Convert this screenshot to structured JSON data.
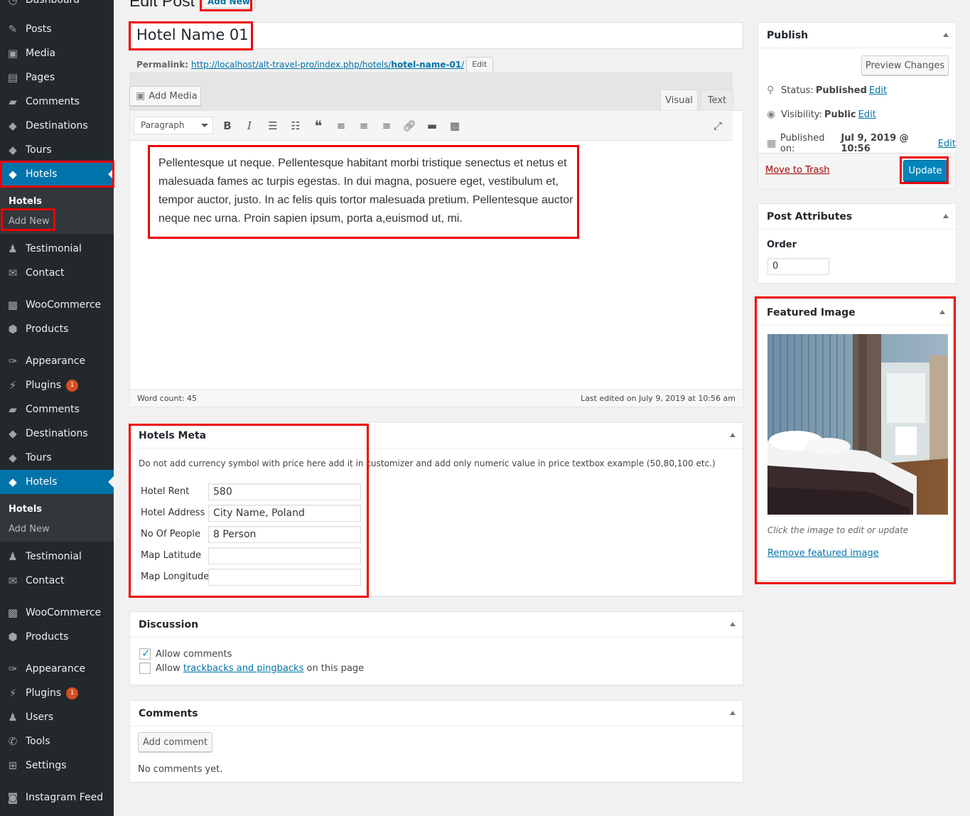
{
  "sidebar": {
    "items": [
      {
        "label": "Dashboard",
        "icon": "dashboard-icon"
      },
      {
        "label": "Posts",
        "icon": "pin-icon"
      },
      {
        "label": "Media",
        "icon": "media-icon"
      },
      {
        "label": "Pages",
        "icon": "pages-icon"
      },
      {
        "label": "Comments",
        "icon": "comment-icon"
      },
      {
        "label": "Destinations",
        "icon": "graduation-cap-icon"
      },
      {
        "label": "Tours",
        "icon": "graduation-cap-icon"
      },
      {
        "label": "Hotels",
        "icon": "graduation-cap-icon"
      },
      {
        "label": "Testimonial",
        "icon": "person-icon"
      },
      {
        "label": "Contact",
        "icon": "envelope-icon"
      },
      {
        "label": "WooCommerce",
        "icon": "woo-icon"
      },
      {
        "label": "Products",
        "icon": "box-icon"
      },
      {
        "label": "Appearance",
        "icon": "brush-icon"
      },
      {
        "label": "Plugins",
        "icon": "plug-icon",
        "badge": "1"
      },
      {
        "label": "Comments",
        "icon": "comment-icon"
      },
      {
        "label": "Destinations",
        "icon": "graduation-cap-icon"
      },
      {
        "label": "Tours",
        "icon": "graduation-cap-icon"
      },
      {
        "label": "Hotels",
        "icon": "graduation-cap-icon"
      },
      {
        "label": "Testimonial",
        "icon": "person-icon"
      },
      {
        "label": "Contact",
        "icon": "envelope-icon"
      },
      {
        "label": "WooCommerce",
        "icon": "woo-icon"
      },
      {
        "label": "Products",
        "icon": "box-icon"
      },
      {
        "label": "Appearance",
        "icon": "brush-icon"
      },
      {
        "label": "Plugins",
        "icon": "plug-icon",
        "badge": "1"
      },
      {
        "label": "Users",
        "icon": "user-icon"
      },
      {
        "label": "Tools",
        "icon": "wrench-icon"
      },
      {
        "label": "Settings",
        "icon": "settings-icon"
      },
      {
        "label": "Instagram Feed",
        "icon": "instagram-icon"
      }
    ],
    "submenu": {
      "hotels": "Hotels",
      "add_new": "Add New"
    }
  },
  "header": {
    "title": "Edit Post",
    "add_new": "Add New"
  },
  "post": {
    "title": "Hotel Name 01",
    "permalink_label": "Permalink:",
    "permalink_base": "http://localhost/alt-travel-pro/index.php/hotels/",
    "permalink_slug": "hotel-name-01",
    "permalink_end": "/",
    "permalink_edit": "Edit"
  },
  "editor": {
    "add_media": "Add Media",
    "tab_visual": "Visual",
    "tab_text": "Text",
    "format": "Paragraph",
    "content": "Pellentesque ut neque. Pellentesque habitant morbi tristique senectus et netus et malesuada fames ac turpis egestas. In dui magna, posuere eget, vestibulum et, tempor auctor, justo. In ac felis quis tortor malesuada pretium. Pellentesque auctor neque nec urna. Proin sapien ipsum, porta a,euismod ut, mi.",
    "word_count": "Word count: 45",
    "last_edited": "Last edited on July 9, 2019 at 10:56 am"
  },
  "hotels_meta": {
    "title": "Hotels Meta",
    "note": "Do not add currency symbol with price here add it in customizer and add only numeric value in price textbox example (50,80,100 etc.)",
    "fields": [
      {
        "label": "Hotel Rent",
        "value": "580"
      },
      {
        "label": "Hotel Address",
        "value": "City Name, Poland"
      },
      {
        "label": "No Of People",
        "value": "8 Person"
      },
      {
        "label": "Map Latitude",
        "value": ""
      },
      {
        "label": "Map Longitude",
        "value": ""
      }
    ]
  },
  "discussion": {
    "title": "Discussion",
    "allow_comments": "Allow comments",
    "allow_prefix": "Allow",
    "trackbacks_link": "trackbacks and pingbacks",
    "allow_suffix": "on this page"
  },
  "comments": {
    "title": "Comments",
    "add_comment": "Add comment",
    "none": "No comments yet."
  },
  "publish": {
    "title": "Publish",
    "preview": "Preview Changes",
    "status_label": "Status:",
    "status_value": "Published",
    "visibility_label": "Visibility:",
    "visibility_value": "Public",
    "published_label": "Published on:",
    "published_value": "Jul 9, 2019 @ 10:56",
    "edit": "Edit",
    "trash": "Move to Trash",
    "update": "Update"
  },
  "attributes": {
    "title": "Post Attributes",
    "order_label": "Order",
    "order_value": "0"
  },
  "featured": {
    "title": "Featured Image",
    "hint": "Click the image to edit or update",
    "remove": "Remove featured image"
  },
  "colors": {
    "accent": "#0073aa",
    "highlight": "#e00000",
    "sidebar": "#23282d"
  }
}
